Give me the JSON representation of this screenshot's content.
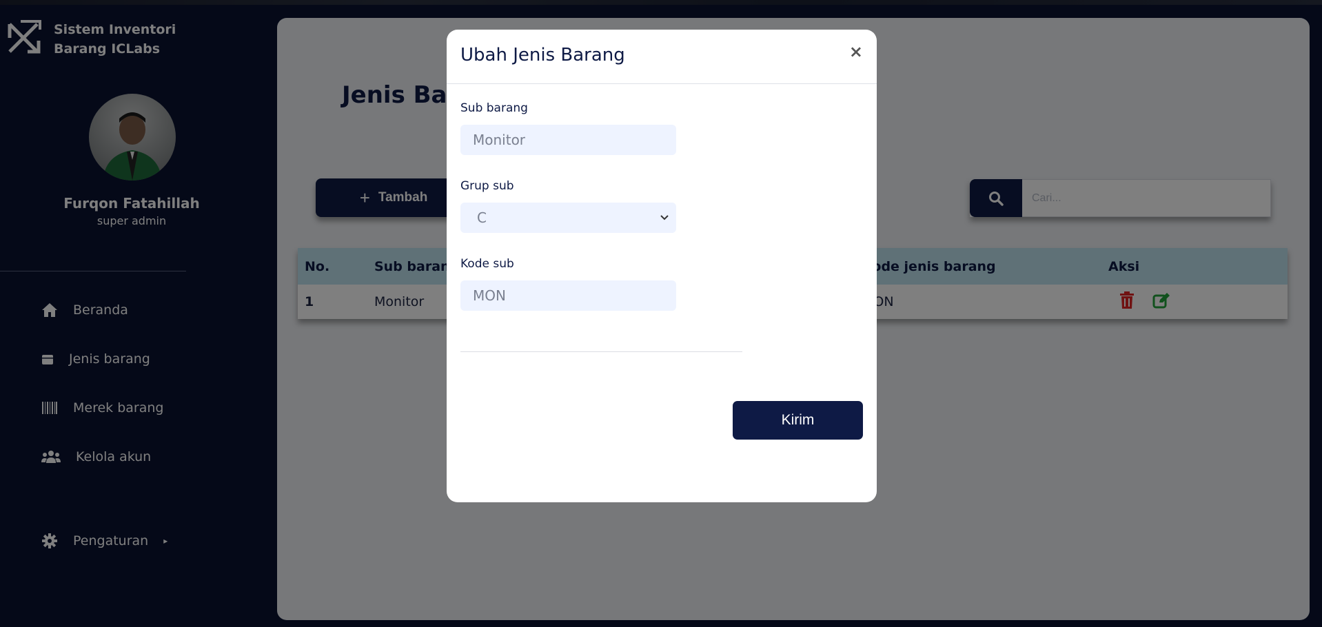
{
  "app": {
    "brand_line1": "Sistem Inventori",
    "brand_line2": "Barang ICLabs"
  },
  "user": {
    "name": "Furqon Fatahillah",
    "role": "super admin"
  },
  "sidebar": {
    "items": [
      {
        "label": "Beranda",
        "icon": "home-icon"
      },
      {
        "label": "Jenis barang",
        "icon": "box-icon"
      },
      {
        "label": "Merek barang",
        "icon": "barcode-icon"
      },
      {
        "label": "Kelola akun",
        "icon": "users-icon"
      },
      {
        "label": "Pengaturan",
        "icon": "gear-icon"
      }
    ]
  },
  "main": {
    "title": "Jenis Barang",
    "add_label": "Tambah",
    "search_placeholder": "Cari...",
    "table": {
      "headers": [
        "No.",
        "Sub barang",
        "Kode jenis barang",
        "Aksi"
      ],
      "rows": [
        {
          "no": "1",
          "sub": "Monitor",
          "kode": "MON"
        }
      ]
    }
  },
  "modal": {
    "title": "Ubah Jenis Barang",
    "close": "×",
    "fields": {
      "sub_label": "Sub barang",
      "sub_value": "Monitor",
      "grup_label": "Grup sub",
      "grup_value": "C",
      "kode_label": "Kode sub",
      "kode_value": "MON"
    },
    "submit_label": "Kirim"
  },
  "colors": {
    "primary": "#0e1a45",
    "sidebar_bg": "#0a1230",
    "table_header": "#bfe3ef",
    "delete": "#e02424",
    "edit": "#22a33a"
  }
}
